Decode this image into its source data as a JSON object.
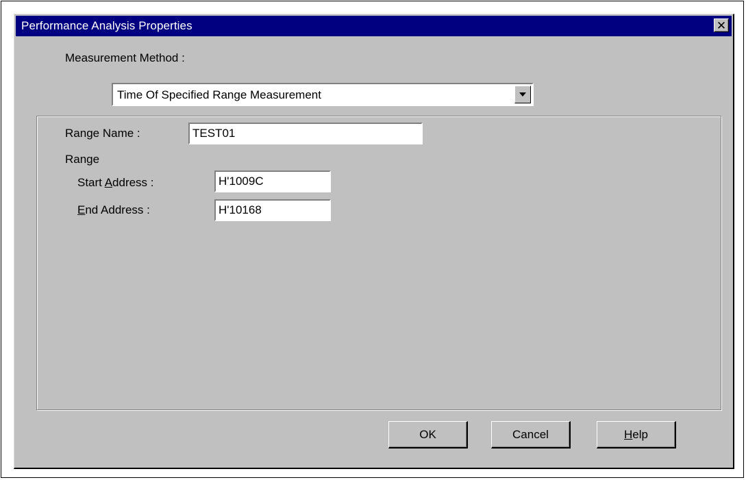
{
  "window": {
    "title": "Performance Analysis Properties",
    "close_glyph": "✕"
  },
  "measurement": {
    "label": "Measurement Method :",
    "selected": "Time Of Specified Range Measurement"
  },
  "range_name": {
    "label_pre": "Ran",
    "label_key": "g",
    "label_post": "e Name :",
    "value": "TEST01"
  },
  "range": {
    "heading": "Range",
    "start": {
      "label_pre": "Start ",
      "label_key": "A",
      "label_post": "ddress :",
      "value": "H'1009C"
    },
    "end": {
      "label_pre": "",
      "label_key": "E",
      "label_post": "nd Address :",
      "value": "H'10168"
    }
  },
  "buttons": {
    "ok": "OK",
    "cancel": "Cancel",
    "help_key": "H",
    "help_post": "elp"
  },
  "colors": {
    "title_bar": "#000080",
    "dialog_face": "#c0c0c0"
  }
}
